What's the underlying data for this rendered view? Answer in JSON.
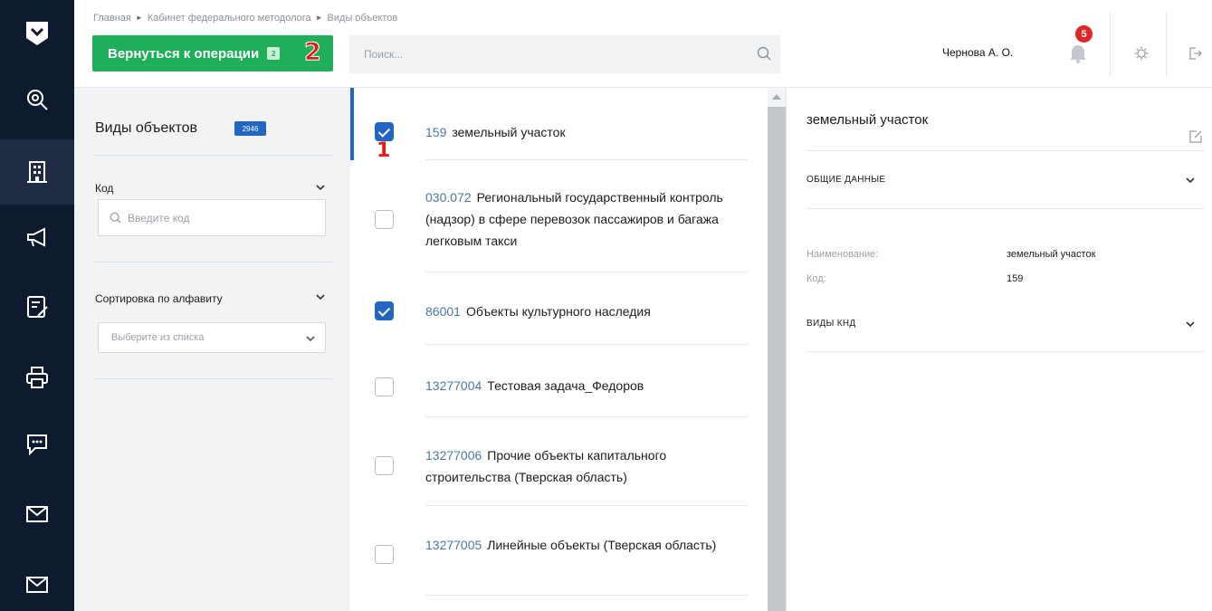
{
  "breadcrumbs": [
    "Главная",
    "Кабинет федерального методолога",
    "Виды объектов"
  ],
  "back_button": {
    "label": "Вернуться к операции",
    "count": "2"
  },
  "annotations": {
    "marker_1": "1",
    "marker_2": "2"
  },
  "search": {
    "placeholder": "Поиск..."
  },
  "user": {
    "name": "Чернова А. О.",
    "notifications": "5"
  },
  "nav": [
    "logo-icon",
    "search-nav-icon",
    "building-icon",
    "megaphone-icon",
    "checklist-icon",
    "printer-icon",
    "chat-icon",
    "mail-icon",
    "mail-icon"
  ],
  "filters": {
    "title": "Виды объектов",
    "count": "2946",
    "code_label": "Код",
    "code_placeholder": "Введите код",
    "sort_label": "Сортировка по алфавиту",
    "sort_placeholder": "Выберите из списка"
  },
  "list": [
    {
      "code": "159",
      "name": "земельный участок",
      "checked": true
    },
    {
      "code": "030.072",
      "name": "Региональный государственный контроль (надзор) в сфере перевозок пассажиров и багажа легковым такси",
      "checked": false
    },
    {
      "code": "86001",
      "name": "Объекты культурного наследия",
      "checked": true
    },
    {
      "code": "13277004",
      "name": "Тестовая задача_Федоров",
      "checked": false
    },
    {
      "code": "13277006",
      "name": "Прочие объекты капитального строительства (Тверская область)",
      "checked": false
    },
    {
      "code": "13277005",
      "name": "Линейные объекты (Тверская область)",
      "checked": false
    }
  ],
  "detail": {
    "title": "земельный участок",
    "section_general": "ОБЩИЕ ДАННЫЕ",
    "name_label": "Наименование:",
    "name_value": "земельный участок",
    "code_label": "Код:",
    "code_value": "159",
    "section_knd": "ВИДЫ КНД"
  },
  "colors": {
    "nav_bg": "#0e1a2e",
    "accent_green": "#21ae5b",
    "accent_blue": "#2266c4",
    "badge_red": "#e02626",
    "marker_red": "#e31b1b"
  }
}
